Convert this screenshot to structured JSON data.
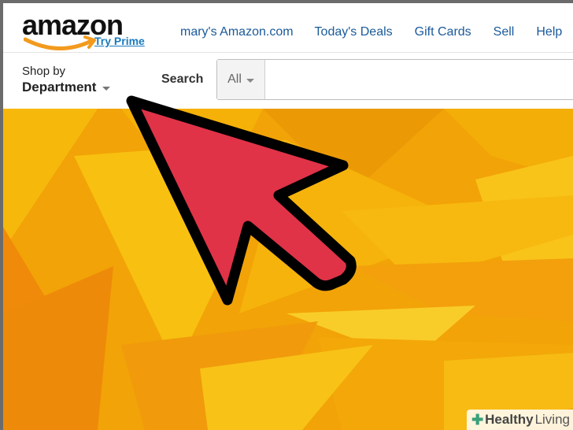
{
  "header": {
    "logo_text": "amazon",
    "try_prime": "Try Prime",
    "nav_links": [
      "mary's Amazon.com",
      "Today's Deals",
      "Gift Cards",
      "Sell",
      "Help"
    ]
  },
  "search_bar": {
    "shop_by_line1": "Shop by",
    "shop_by_line2": "Department",
    "search_label": "Search",
    "category_value": "All",
    "input_value": ""
  },
  "overlay": {
    "arrow_color": "#e03348",
    "hero_color": "#f2a307"
  },
  "watermark": {
    "part1": "Healthy",
    "part2": "Living"
  }
}
